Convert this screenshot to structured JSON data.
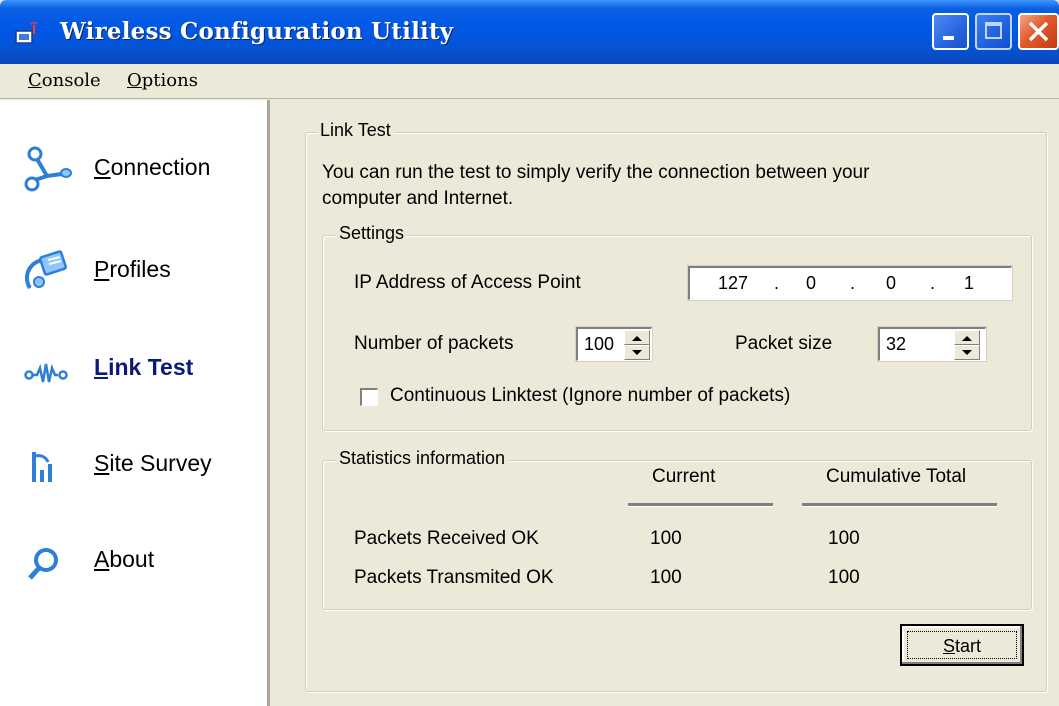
{
  "window": {
    "title": "Wireless Configuration Utility"
  },
  "menu": {
    "console": {
      "first": "C",
      "rest": "onsole"
    },
    "options": {
      "first": "O",
      "rest": "ptions"
    }
  },
  "sidebar": {
    "items": [
      {
        "first": "C",
        "rest": "onnection",
        "icon": "connection-icon"
      },
      {
        "first": "P",
        "rest": "rofiles",
        "icon": "profiles-icon"
      },
      {
        "first": "L",
        "rest": "ink Test",
        "icon": "link-test-icon",
        "active": true
      },
      {
        "first": "S",
        "rest": "ite Survey",
        "icon": "site-survey-icon"
      },
      {
        "first": "A",
        "rest": "bout",
        "icon": "about-icon"
      }
    ]
  },
  "link_test": {
    "legend": "Link Test",
    "description_line1": "You can run the test to simply verify the connection between your",
    "description_line2": "computer and Internet.",
    "settings": {
      "legend": "Settings",
      "ip_label": "IP Address of Access Point",
      "ip": [
        "127",
        "0",
        "0",
        "1"
      ],
      "ip_dot": ".",
      "packets_label": "Number of packets",
      "packets_value": "100",
      "packet_size_label": "Packet size",
      "packet_size_value": "32",
      "continuous_label": "Continuous Linktest (Ignore number of packets)",
      "continuous_checked": false
    },
    "statistics": {
      "legend": "Statistics information",
      "col_current": "Current",
      "col_cumulative": "Cumulative Total",
      "rows": [
        {
          "label": "Packets Received OK",
          "current": "100",
          "cumulative": "100"
        },
        {
          "label": "Packets Transmited OK",
          "current": "100",
          "cumulative": "100"
        }
      ]
    },
    "start": {
      "first": "S",
      "rest": "tart"
    }
  },
  "colors": {
    "titlebar": "#0058e6",
    "panel": "#ece9d8",
    "active_nav": "#0a1a7a",
    "icon_blue": "#2f7fd8"
  }
}
